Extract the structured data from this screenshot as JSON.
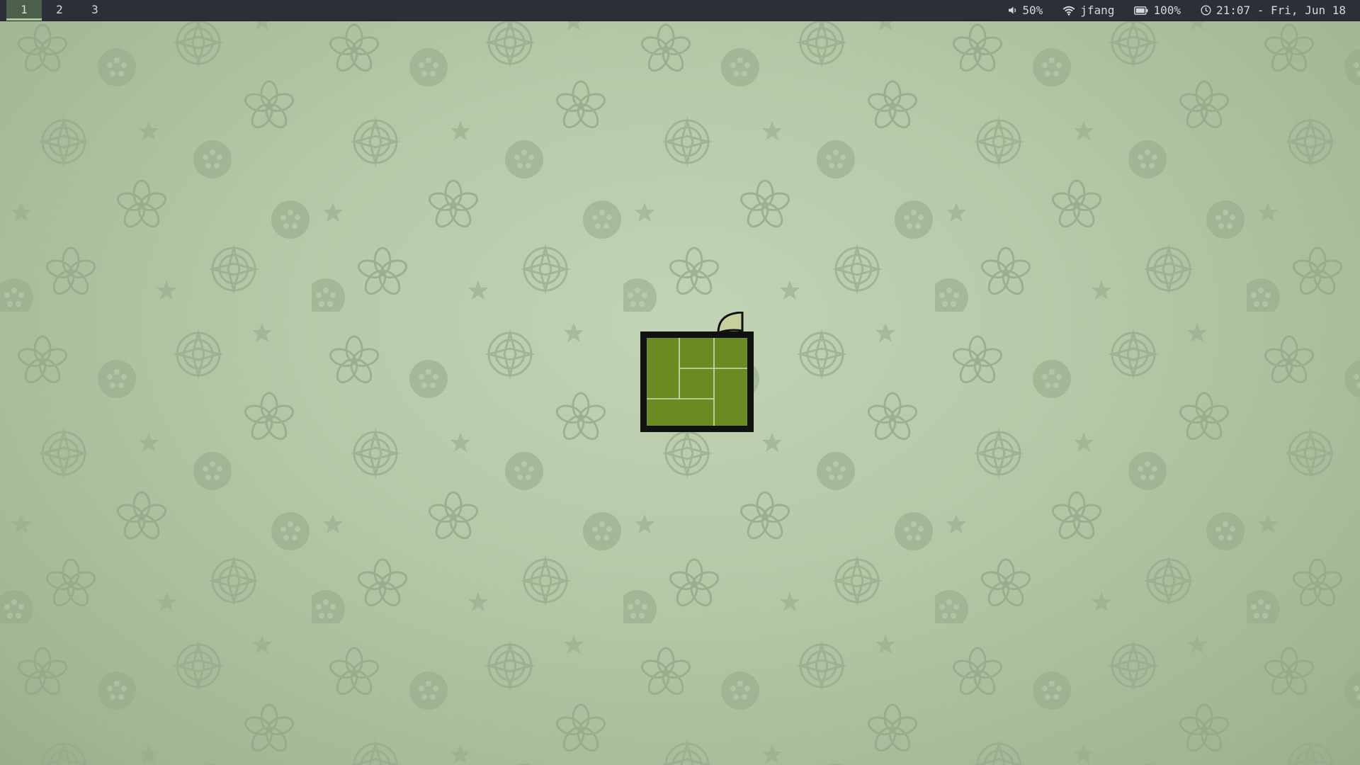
{
  "workspaces": [
    {
      "label": "1",
      "active": true
    },
    {
      "label": "2",
      "active": false
    },
    {
      "label": "3",
      "active": false
    }
  ],
  "status": {
    "volume": "50%",
    "wifi": "jfang",
    "battery": "100%",
    "clock": "21:07 - Fri, Jun 18"
  },
  "icons": {
    "volume": "speaker-icon",
    "wifi": "wifi-icon",
    "battery": "battery-icon",
    "clock": "clock-icon"
  },
  "colors": {
    "bar_background": "#2b2f37",
    "active_workspace": "#4b5f4a",
    "active_underline": "#a9c99a",
    "logo_green": "#6a8a22",
    "logo_border": "#111111",
    "logo_leaf": "#c8cf9f",
    "wallpaper": "#b4c8a6"
  }
}
